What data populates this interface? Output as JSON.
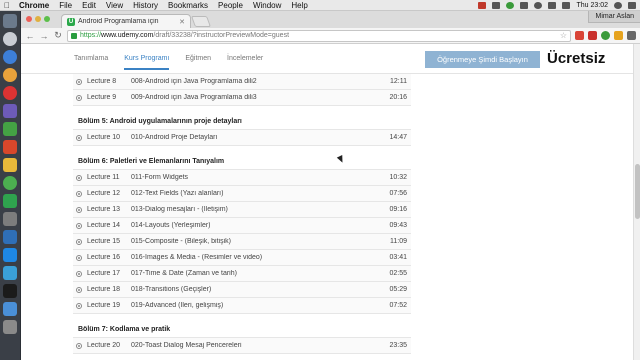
{
  "menubar": {
    "app": "Chrome",
    "menus": [
      "File",
      "Edit",
      "View",
      "History",
      "Bookmarks",
      "People",
      "Window",
      "Help"
    ],
    "clock": "Thu 23:02"
  },
  "browser": {
    "tab_title": "Android Programlama için",
    "profile_name": "Mimar Aslan",
    "url_scheme": "https://",
    "url_host": "www.udemy.com",
    "url_path": "/draft/33238/?instructorPreviewMode=guest"
  },
  "page": {
    "subnav_tabs": [
      {
        "label": "Tanımlama",
        "active": false
      },
      {
        "label": "Kurs Programı",
        "active": true
      },
      {
        "label": "Eğitmen",
        "active": false
      },
      {
        "label": "İncelemeler",
        "active": false
      }
    ],
    "enroll_label": "Öğrenmeye Şimdi Başlayın",
    "price_label": "Ücretsiz"
  },
  "curriculum": [
    {
      "type": "lecture",
      "lecture": "Lecture 8",
      "title": "008-Android için Java Programlama dili2",
      "duration": "12:11"
    },
    {
      "type": "lecture",
      "lecture": "Lecture 9",
      "title": "009-Android için Java Programlama dili3",
      "duration": "20:16"
    },
    {
      "type": "section",
      "title": "Bölüm 5: Android uygulamalarının proje detayları"
    },
    {
      "type": "lecture",
      "lecture": "Lecture 10",
      "title": "010-Android Proje Detayları",
      "duration": "14:47"
    },
    {
      "type": "section",
      "title": "Bölüm 6: Paletleri ve Elemanlarını Tanıyalım"
    },
    {
      "type": "lecture",
      "lecture": "Lecture 11",
      "title": "011-Form Widgets",
      "duration": "10:32"
    },
    {
      "type": "lecture",
      "lecture": "Lecture 12",
      "title": "012-Text Fields (Yazı alanları)",
      "duration": "07:56"
    },
    {
      "type": "lecture",
      "lecture": "Lecture 13",
      "title": "013-Dialog mesajları - (İletişim)",
      "duration": "09:16"
    },
    {
      "type": "lecture",
      "lecture": "Lecture 14",
      "title": "014-Layouts (Yerleşimler)",
      "duration": "09:43"
    },
    {
      "type": "lecture",
      "lecture": "Lecture 15",
      "title": "015-Composite - (Bileşik, bitişik)",
      "duration": "11:09"
    },
    {
      "type": "lecture",
      "lecture": "Lecture 16",
      "title": "016-Images & Media - (Resimler ve video)",
      "duration": "03:41"
    },
    {
      "type": "lecture",
      "lecture": "Lecture 17",
      "title": "017-Time & Date (Zaman ve tarih)",
      "duration": "02:55"
    },
    {
      "type": "lecture",
      "lecture": "Lecture 18",
      "title": "018-Transitions (Geçişler)",
      "duration": "05:29"
    },
    {
      "type": "lecture",
      "lecture": "Lecture 19",
      "title": "019-Advanced (İleri, gelişmiş)",
      "duration": "07:52"
    },
    {
      "type": "section",
      "title": "Bölüm 7: Kodlama ve pratik"
    },
    {
      "type": "lecture",
      "lecture": "Lecture 20",
      "title": "020-Toast Dialog Mesaj Pencereleri",
      "duration": "23:35"
    }
  ],
  "colors": {
    "accent": "#3b82c4",
    "enroll_bg": "#8fb3d3",
    "secure_green": "#2a9d3f"
  }
}
